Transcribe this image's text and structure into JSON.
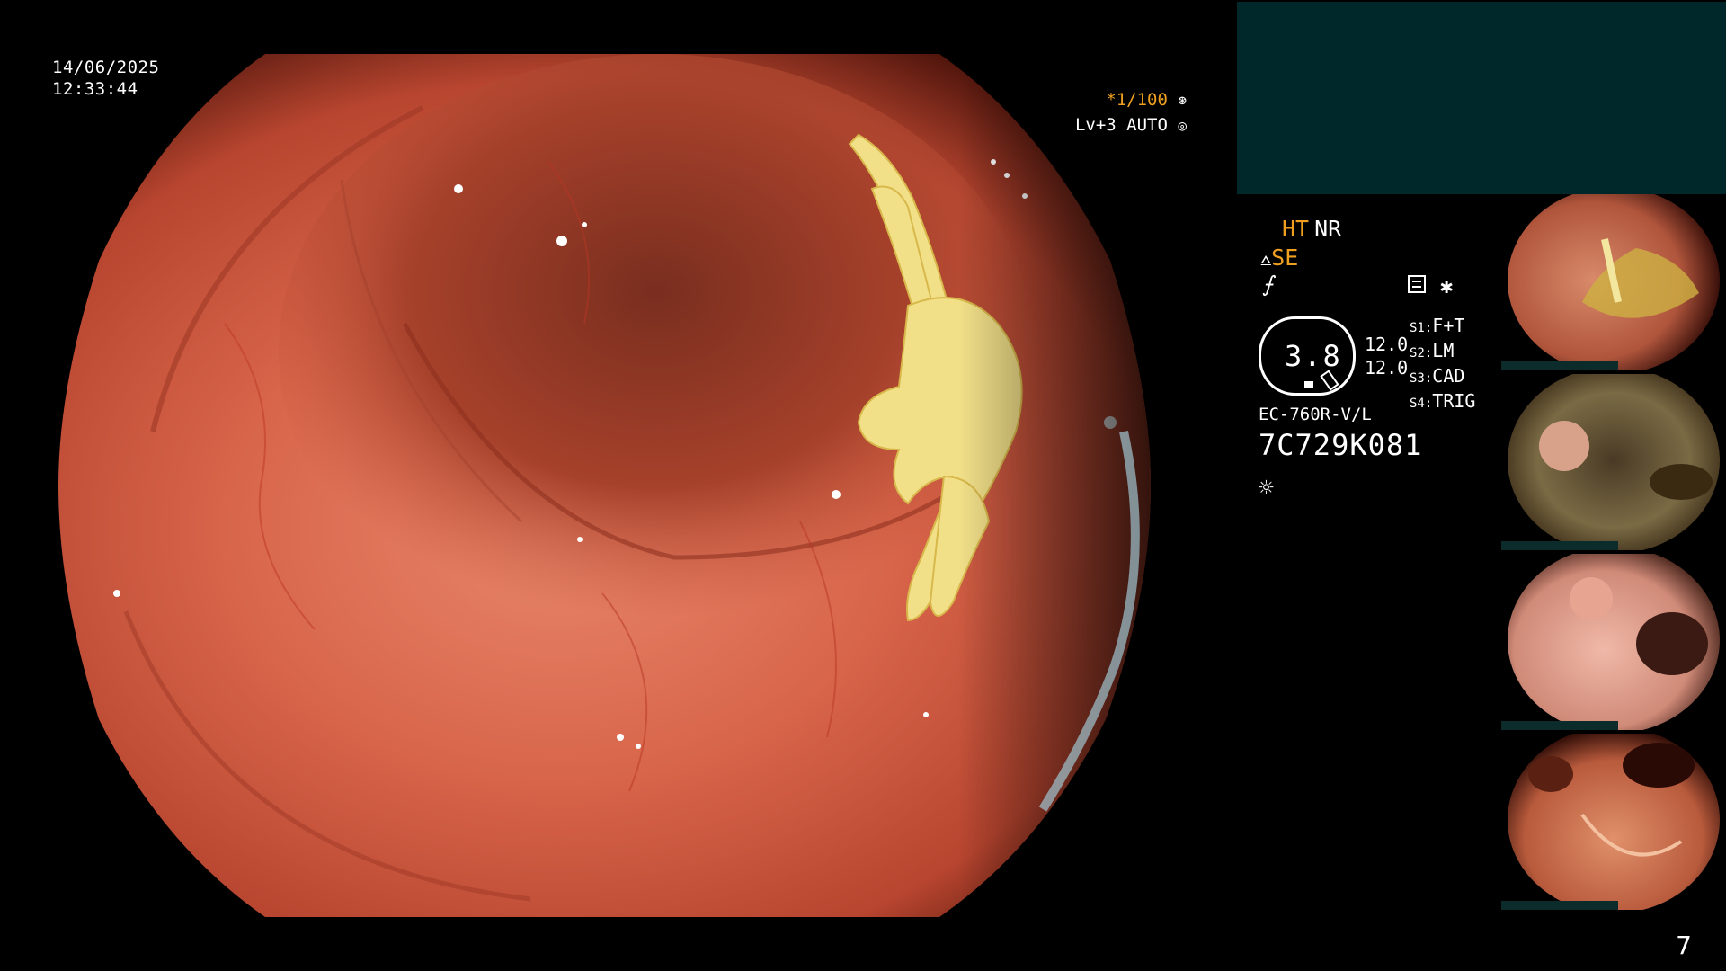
{
  "timestamp": {
    "date": "14/06/2025",
    "time": "12:33:44"
  },
  "overlay": {
    "magnification": "*1/100",
    "level": "Lv+3 AUTO"
  },
  "status": {
    "ht": "HT",
    "nr": "NR",
    "se": "SE",
    "scope_value": "3.8",
    "values": [
      "12.0",
      "12.0"
    ],
    "switches": [
      {
        "key": "S1:",
        "label": "F+T"
      },
      {
        "key": "S2:",
        "label": "LM"
      },
      {
        "key": "S3:",
        "label": "CAD"
      },
      {
        "key": "S4:",
        "label": "TRIG"
      }
    ],
    "model": "EC-760R-V/L",
    "serial": "7C729K081"
  },
  "page_number": "7",
  "icons": {
    "shutter": "shutter-icon",
    "auto": "auto-iris-icon",
    "structure": "structure-enhance-icon",
    "freeze": "freeze-icon",
    "memory": "memory-icon",
    "star": "star-icon",
    "light": "light-icon"
  },
  "colors": {
    "accent": "#f0a020",
    "panel": "#00272a",
    "background": "#000000"
  }
}
